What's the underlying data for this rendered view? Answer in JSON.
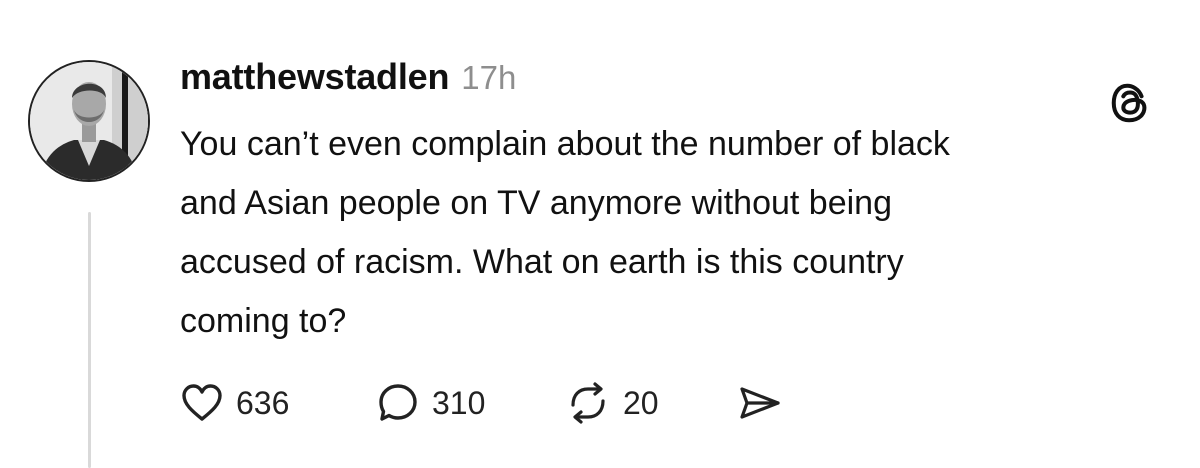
{
  "post": {
    "author": "matthewstadlen",
    "time": "17h",
    "text_lines": [
      "You can’t even complain about the number of black",
      "and Asian people on TV anymore without being",
      "accused of racism. What on earth is this country",
      "coming to?"
    ]
  },
  "actions": {
    "likes": "636",
    "replies": "310",
    "reposts": "20"
  },
  "icons": {
    "like": "heart-icon",
    "reply": "speech-bubble-icon",
    "repost": "repost-arrows-icon",
    "share": "send-icon",
    "app": "threads-logo-icon"
  },
  "colors": {
    "text": "#111111",
    "muted": "#8e8e8e",
    "thread_line": "#d9d9d9"
  }
}
